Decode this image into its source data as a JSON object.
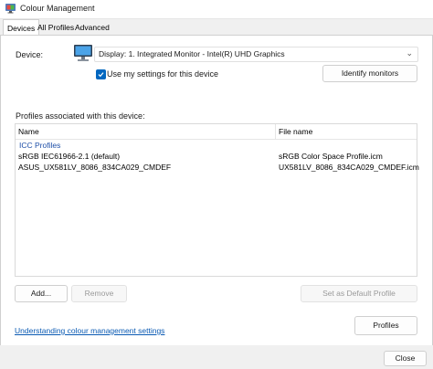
{
  "window": {
    "title": "Colour Management"
  },
  "tabs": [
    {
      "label": "Devices"
    },
    {
      "label": "All Profiles"
    },
    {
      "label": "Advanced"
    }
  ],
  "device": {
    "label": "Device:",
    "selected": "Display: 1. Integrated Monitor - Intel(R) UHD Graphics",
    "use_settings_label": "Use my settings for this device",
    "identify_label": "Identify monitors"
  },
  "profiles": {
    "section_label": "Profiles associated with this device:",
    "columns": {
      "name": "Name",
      "file": "File name"
    },
    "group": "ICC Profiles",
    "rows": [
      {
        "name": "sRGB IEC61966-2.1 (default)",
        "file": "sRGB Color Space Profile.icm"
      },
      {
        "name": "ASUS_UX581LV_8086_834CA029_CMDEF",
        "file": "UX581LV_8086_834CA029_CMDEF.icm"
      }
    ]
  },
  "buttons": {
    "add": "Add...",
    "remove": "Remove",
    "set_default": "Set as Default Profile",
    "profiles": "Profiles",
    "close": "Close"
  },
  "link": {
    "text": "Understanding colour management settings"
  },
  "colors": {
    "accent": "#0067c0",
    "link": "#0a5ab3",
    "group": "#1e4fa8"
  }
}
